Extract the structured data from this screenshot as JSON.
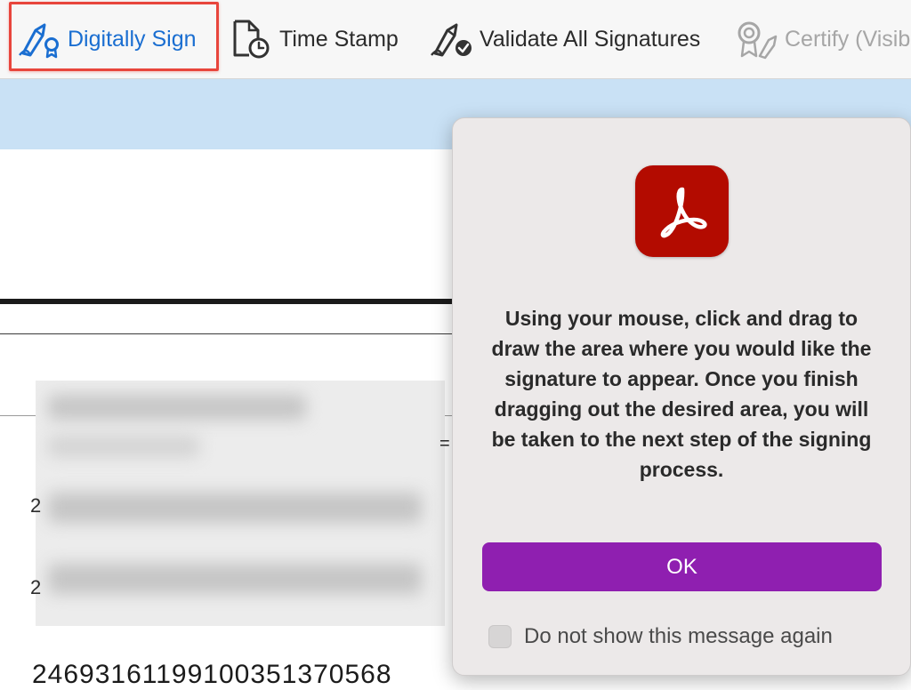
{
  "toolbar": {
    "items": [
      {
        "label": "Digitally Sign",
        "icon": "pen-signature-icon",
        "highlighted": true,
        "color": "#1a6ed1"
      },
      {
        "label": "Time Stamp",
        "icon": "document-clock-icon"
      },
      {
        "label": "Validate All Signatures",
        "icon": "pen-checkmark-icon"
      },
      {
        "label": "Certify (Visib",
        "icon": "certify-ribbon-icon",
        "disabled": true
      }
    ],
    "highlight_color": "#e8453c"
  },
  "document": {
    "visible_number": "24693161199100351370568",
    "marks": [
      "2",
      "2",
      "="
    ]
  },
  "popup": {
    "icon": "adobe-acrobat-icon",
    "icon_color": "#b30b00",
    "message": "Using your mouse, click and drag to draw the area where you would like the signature to appear. Once you finish dragging out the desired area, you will be taken to the next step of the signing process.",
    "ok_label": "OK",
    "ok_color": "#8f1fb0",
    "checkbox_label": "Do not show this message again",
    "checkbox_checked": false
  }
}
